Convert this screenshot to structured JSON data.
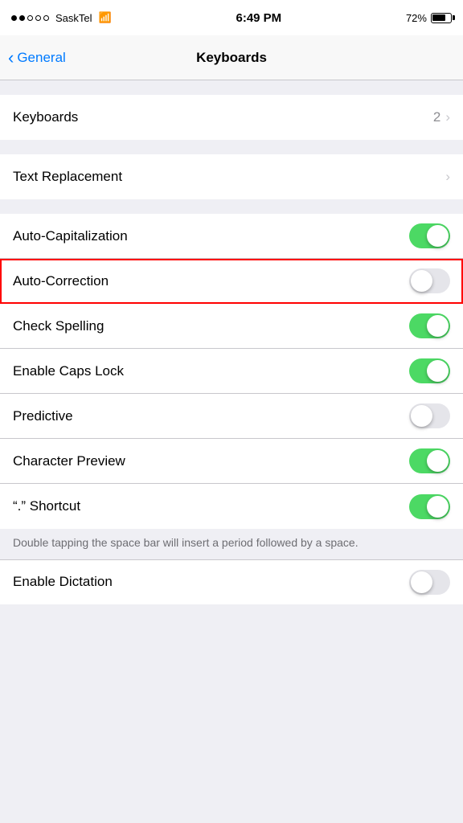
{
  "statusBar": {
    "carrier": "SaskTel",
    "time": "6:49 PM",
    "battery": "72%"
  },
  "navBar": {
    "backLabel": "General",
    "title": "Keyboards"
  },
  "sections": [
    {
      "rows": [
        {
          "id": "keyboards",
          "label": "Keyboards",
          "value": "2",
          "hasChevron": true,
          "hasToggle": false,
          "toggleOn": false,
          "highlighted": false
        }
      ]
    },
    {
      "rows": [
        {
          "id": "text-replacement",
          "label": "Text Replacement",
          "value": "",
          "hasChevron": true,
          "hasToggle": false,
          "toggleOn": false,
          "highlighted": false
        }
      ]
    },
    {
      "rows": [
        {
          "id": "auto-capitalization",
          "label": "Auto-Capitalization",
          "value": "",
          "hasChevron": false,
          "hasToggle": true,
          "toggleOn": true,
          "highlighted": false
        },
        {
          "id": "auto-correction",
          "label": "Auto-Correction",
          "value": "",
          "hasChevron": false,
          "hasToggle": true,
          "toggleOn": false,
          "highlighted": true
        },
        {
          "id": "check-spelling",
          "label": "Check Spelling",
          "value": "",
          "hasChevron": false,
          "hasToggle": true,
          "toggleOn": true,
          "highlighted": false
        },
        {
          "id": "enable-caps-lock",
          "label": "Enable Caps Lock",
          "value": "",
          "hasChevron": false,
          "hasToggle": true,
          "toggleOn": true,
          "highlighted": false
        },
        {
          "id": "predictive",
          "label": "Predictive",
          "value": "",
          "hasChevron": false,
          "hasToggle": true,
          "toggleOn": false,
          "highlighted": false
        },
        {
          "id": "character-preview",
          "label": "Character Preview",
          "value": "",
          "hasChevron": false,
          "hasToggle": true,
          "toggleOn": true,
          "highlighted": false
        },
        {
          "id": "period-shortcut",
          "label": "“.” Shortcut",
          "value": "",
          "hasChevron": false,
          "hasToggle": true,
          "toggleOn": true,
          "highlighted": false
        }
      ]
    }
  ],
  "sectionNote": "Double tapping the space bar will insert a period followed by a space.",
  "bottomSection": {
    "rows": [
      {
        "id": "enable-dictation",
        "label": "Enable Dictation",
        "value": "",
        "hasChevron": false,
        "hasToggle": true,
        "toggleOn": false,
        "highlighted": false
      }
    ]
  }
}
